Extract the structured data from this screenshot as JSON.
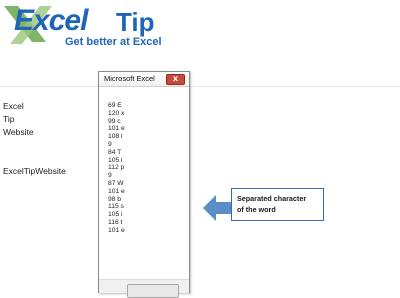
{
  "logo": {
    "word": "Excel",
    "tip": "Tip",
    "tagline": "Get better at Excel"
  },
  "cells": [
    "Excel",
    "Tip",
    "Website",
    "ExcelTipWebsite"
  ],
  "msgbox": {
    "title": "Microsoft Excel",
    "close_label": "x",
    "lines": [
      "69 E",
      "120 x",
      "99 c",
      "101 e",
      "108 l",
      "9",
      "84 T",
      "105 i",
      "112 p",
      "9",
      "87 W",
      "101 e",
      "98 b",
      "115 s",
      "105 i",
      "116 t",
      "101 e"
    ]
  },
  "callout": {
    "line1": "Separated character",
    "line2": "of the word"
  },
  "colors": {
    "brand_blue": "#1f66b8",
    "logo_x_green": "#6aa84f",
    "arrow_blue": "#5b8fc9",
    "close_red": "#c74a3a"
  }
}
